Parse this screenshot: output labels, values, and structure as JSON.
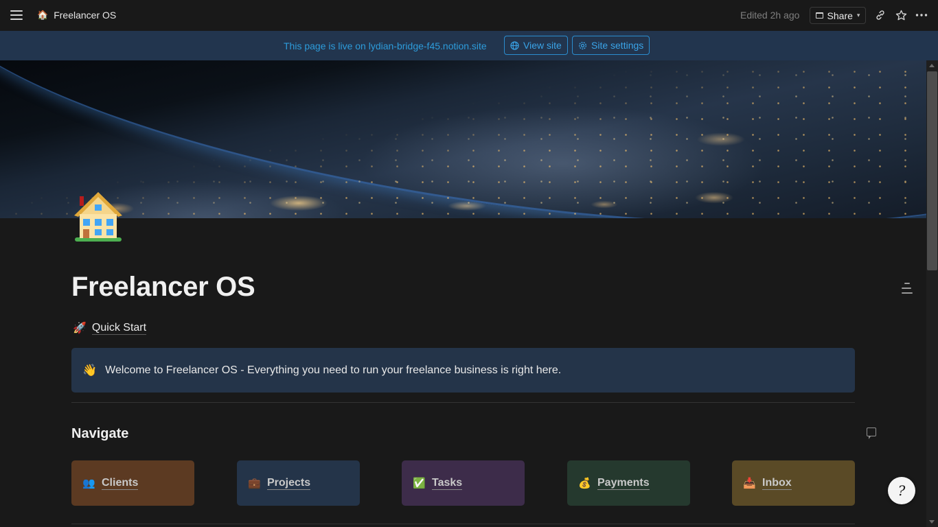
{
  "topbar": {
    "page_emoji": "🏠",
    "page_title": "Freelancer OS",
    "edited": "Edited 2h ago",
    "share_label": "Share"
  },
  "banner": {
    "text": "This page is live on lydian-bridge-f45.notion.site",
    "view_site": "View site",
    "site_settings": "Site settings"
  },
  "page": {
    "title": "Freelancer OS",
    "quick_start_emoji": "🚀",
    "quick_start": "Quick Start",
    "callout_emoji": "👋",
    "callout_text": "Welcome to Freelancer OS - Everything you need to run your freelance business is right here.",
    "navigate_heading": "Navigate"
  },
  "nav_cards": [
    {
      "emoji": "👥",
      "label": "Clients",
      "color": "#5c3a22"
    },
    {
      "emoji": "💼",
      "label": "Projects",
      "color": "#243449"
    },
    {
      "emoji": "✅",
      "label": "Tasks",
      "color": "#3d2c4a"
    },
    {
      "emoji": "💰",
      "label": "Payments",
      "color": "#25392e"
    },
    {
      "emoji": "📥",
      "label": "Inbox",
      "color": "#5a4a26"
    }
  ],
  "help": {
    "glyph": "?"
  }
}
